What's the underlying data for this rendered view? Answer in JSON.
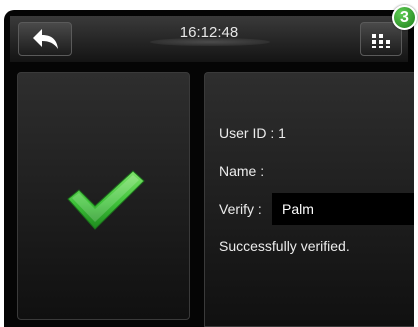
{
  "topbar": {
    "time": "16:12:48",
    "step_badge": "3",
    "back_icon": "back-arrow-icon",
    "menu_icon": "grid-menu-icon"
  },
  "result": {
    "icon": "checkmark-icon",
    "icon_color": "#3fc23a"
  },
  "info": {
    "user_id_label": "User ID : 1",
    "name_label": "Name :",
    "verify_label": "Verify :",
    "verify_value": "Palm",
    "status_text": "Successfully verified."
  }
}
